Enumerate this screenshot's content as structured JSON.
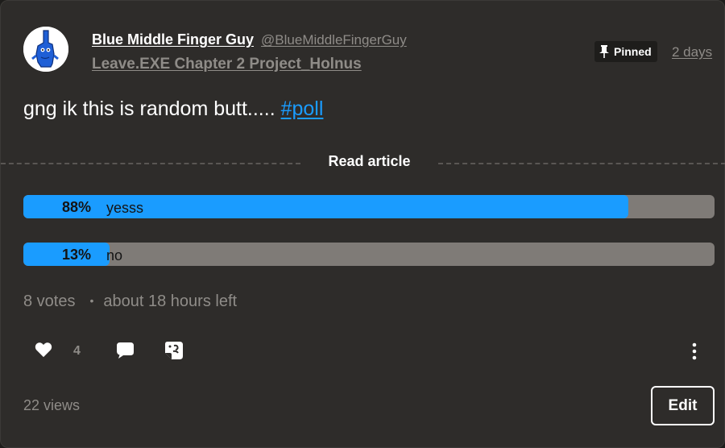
{
  "post": {
    "author": {
      "name": "Blue Middle Finger Guy",
      "handle": "@BlueMiddleFingerGuy",
      "avatar_icon": "blue-character-avatar"
    },
    "project": "Leave.EXE Chapter 2 Project_Holnus",
    "pinned_label": "Pinned",
    "time_ago": "2 days",
    "text": "gng ik this is random butt..... ",
    "hashtag": "#poll",
    "read_article": "Read article"
  },
  "poll": {
    "options": [
      {
        "percent_label": "88%",
        "label": "yesss",
        "fill_fraction": 0.875
      },
      {
        "percent_label": "13%",
        "label": "no",
        "fill_fraction": 0.125
      }
    ],
    "votes": "8 votes",
    "separator": "•",
    "time_left": "about 18 hours left"
  },
  "actions": {
    "like_count": "4",
    "icons": [
      "heart-icon",
      "comment-icon",
      "repost-icon",
      "more-icon"
    ]
  },
  "footer": {
    "views": "22 views",
    "edit_label": "Edit"
  },
  "colors": {
    "background": "#2e2c2a",
    "accent": "#1a9cff",
    "poll_track": "#7f7b77",
    "muted_text": "#8f8c88"
  }
}
